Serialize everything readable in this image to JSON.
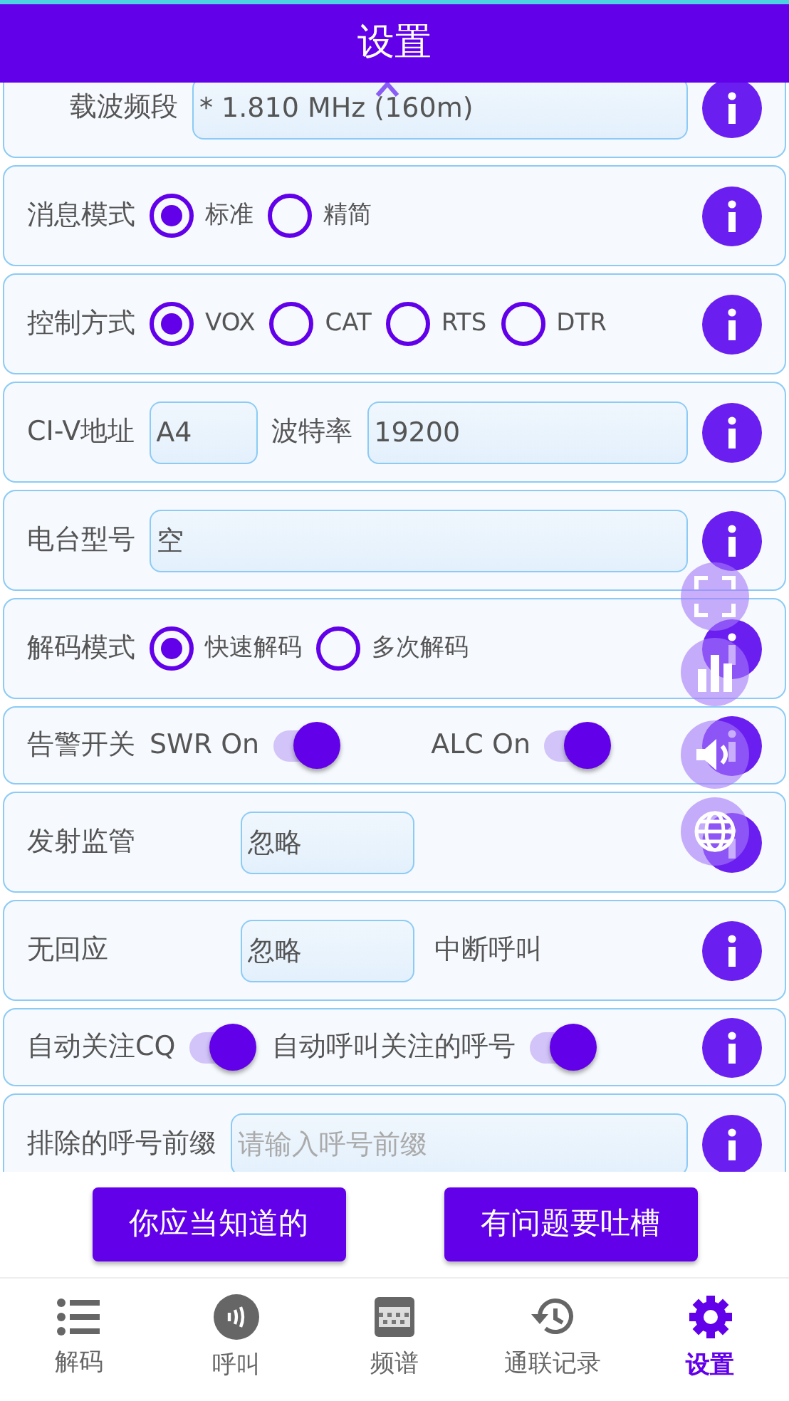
{
  "title": "设置",
  "rows": [
    {
      "label": "载波频段",
      "items": [
        {
          "kind": "field",
          "value": "* 1.810 MHz (160m)"
        }
      ]
    },
    {
      "label": "消息模式",
      "items": [
        {
          "kind": "radio",
          "label": "标准",
          "selected": true
        },
        {
          "kind": "radio",
          "label": "精简",
          "selected": false
        }
      ]
    },
    {
      "label": "控制方式",
      "items": [
        {
          "kind": "radio",
          "label": "VOX",
          "selected": true
        },
        {
          "kind": "radio",
          "label": "CAT",
          "selected": false
        },
        {
          "kind": "radio",
          "label": "RTS",
          "selected": false
        },
        {
          "kind": "radio",
          "label": "DTR",
          "selected": false
        }
      ]
    },
    {
      "label": "CI-V地址",
      "items": [
        {
          "kind": "compact_field",
          "value": "A4"
        },
        {
          "kind": "text",
          "text": "波特率"
        },
        {
          "kind": "field",
          "value": "19200"
        }
      ]
    },
    {
      "label": "电台型号",
      "items": [
        {
          "kind": "field",
          "value": "空"
        }
      ]
    },
    {
      "label": "解码模式",
      "items": [
        {
          "kind": "radio",
          "label": "快速解码",
          "selected": true
        },
        {
          "kind": "radio",
          "label": "多次解码",
          "selected": false
        }
      ]
    },
    {
      "label": "告警开关",
      "items": [
        {
          "kind": "switch",
          "label": "SWR On",
          "on": true
        },
        {
          "kind": "switch",
          "label": "ALC On",
          "on": true
        }
      ]
    },
    {
      "label": "发射监管",
      "items": [
        {
          "kind": "compact_field",
          "value": "忽略"
        }
      ]
    },
    {
      "label": "无回应",
      "items": [
        {
          "kind": "compact_field",
          "value": "忽略"
        },
        {
          "kind": "text",
          "text": "中断呼叫"
        }
      ]
    },
    {
      "items": [
        {
          "kind": "switch",
          "label": "自动关注CQ",
          "on": true
        },
        {
          "kind": "switch",
          "label": "自动呼叫关注的呼号",
          "on": true
        }
      ]
    },
    {
      "label": "排除的呼号前缀",
      "items": [
        {
          "kind": "field",
          "placeholder": "请输入呼号前缀"
        }
      ]
    }
  ],
  "buttons": [
    "你应当知道的",
    "有问题要吐槽"
  ],
  "nav": [
    {
      "label": "解码",
      "selected": false
    },
    {
      "label": "呼叫",
      "selected": false
    },
    {
      "label": "频谱",
      "selected": false
    },
    {
      "label": "通联记录",
      "selected": false
    },
    {
      "label": "设置",
      "selected": true
    }
  ]
}
